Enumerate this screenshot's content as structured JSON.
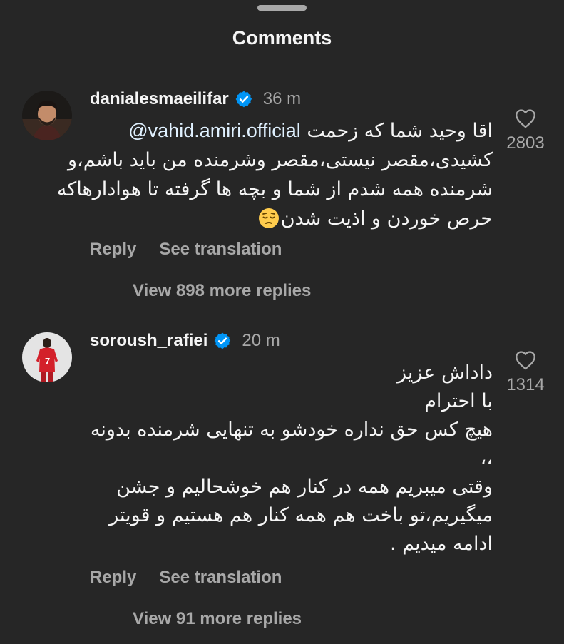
{
  "header": {
    "title": "Comments"
  },
  "comments": [
    {
      "username": "danialesmaeilifar",
      "verified": true,
      "time": "36 m",
      "mention": "@vahid.amiri.official",
      "text_lines": [
        "اقا وحید شما که زحمت",
        "کشیدی،مقصر نیستی،مقصر وشرمنده من باید باشم،و",
        "شرمنده همه شدم از شما و بچه ها گرفته تا هوادارهاکه",
        "حرص خوردن و اذیت شدن"
      ],
      "emoji": "pensive-face-emoji",
      "likes": "2803",
      "reply_label": "Reply",
      "translate_label": "See translation",
      "view_replies_label": "View 898 more replies"
    },
    {
      "username": "soroush_rafiei",
      "verified": true,
      "time": "20 m",
      "text_lines": [
        "داداش عزیز",
        "با احترام",
        "هیچ کس حق نداره خودشو به تنهایی شرمنده بدونه",
        "،،",
        "وقتی میبریم همه در کنار هم خوشحالیم و جشن",
        "میگیریم،تو باخت هم همه کنار هم هستیم و قویتر",
        "ادامه میدیم ."
      ],
      "likes": "1314",
      "reply_label": "Reply",
      "translate_label": "See translation",
      "view_replies_label": "View 91 more replies"
    }
  ],
  "colors": {
    "background": "#262626",
    "primary_text": "#f5f5f5",
    "secondary_text": "#a8a8a8",
    "verified_badge": "#0095f6",
    "mention": "#e0f1ff"
  }
}
